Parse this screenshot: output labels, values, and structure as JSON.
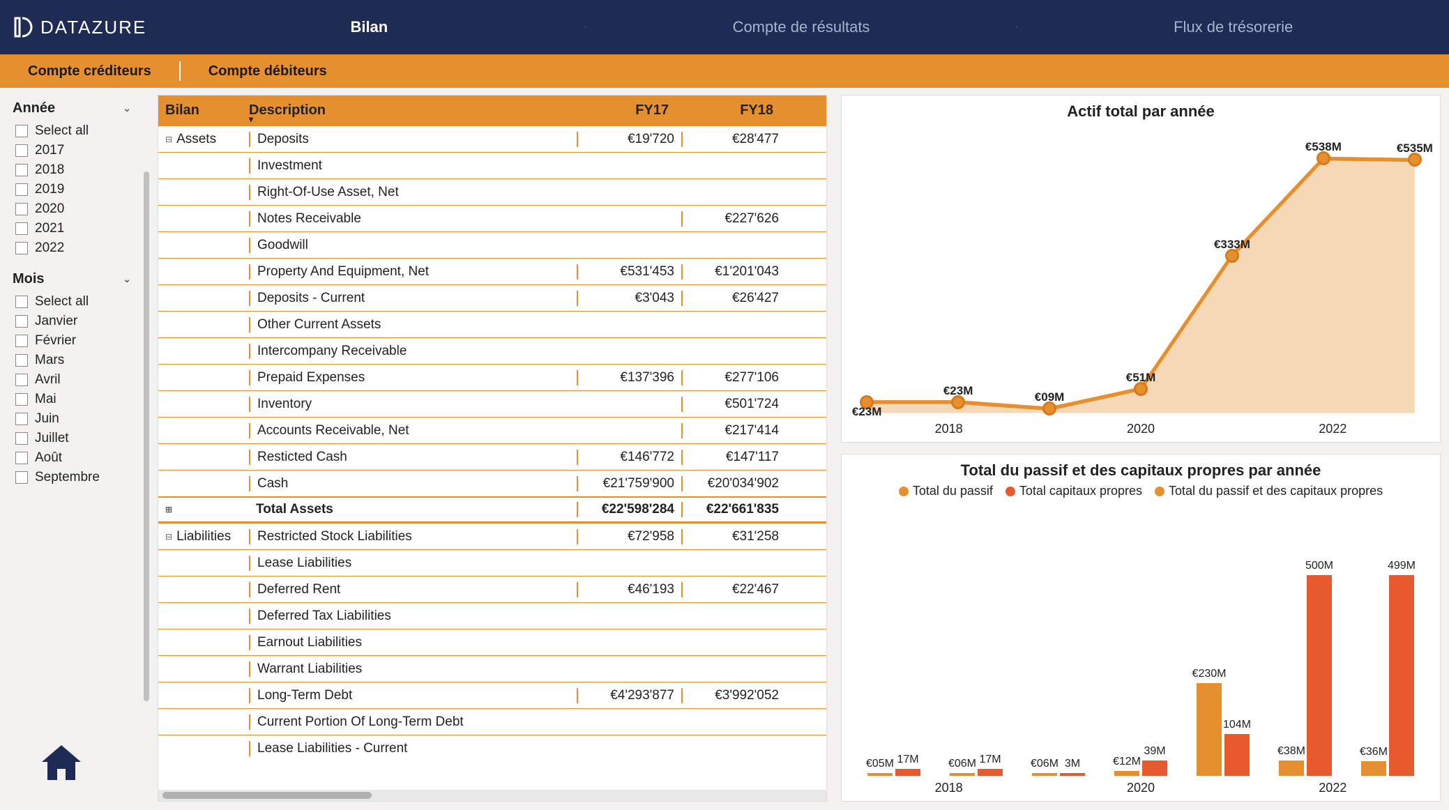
{
  "brand": "DATAZURE",
  "topnav": {
    "tabs": [
      {
        "label": "Bilan",
        "active": true
      },
      {
        "label": "Compte de résultats",
        "active": false
      },
      {
        "label": "Flux de trésorerie",
        "active": false
      }
    ]
  },
  "subnav": {
    "tabs": [
      {
        "label": "Compte créditeurs"
      },
      {
        "label": "Compte débiteurs"
      }
    ]
  },
  "filters": {
    "year": {
      "title": "Année",
      "select_all": "Select all",
      "items": [
        "2017",
        "2018",
        "2019",
        "2020",
        "2021",
        "2022"
      ]
    },
    "month": {
      "title": "Mois",
      "select_all": "Select all",
      "items": [
        "Janvier",
        "Février",
        "Mars",
        "Avril",
        "Mai",
        "Juin",
        "Juillet",
        "Août",
        "Septembre"
      ]
    }
  },
  "table": {
    "headers": {
      "bilan": "Bilan",
      "desc": "Description",
      "fy17": "FY17",
      "fy18": "FY18"
    },
    "groups": [
      {
        "name": "Assets",
        "expanded": true,
        "rows": [
          {
            "desc": "Deposits",
            "fy17": "€19'720",
            "fy18": "€28'477"
          },
          {
            "desc": "Investment",
            "fy17": "",
            "fy18": ""
          },
          {
            "desc": "Right-Of-Use Asset, Net",
            "fy17": "",
            "fy18": ""
          },
          {
            "desc": "Notes Receivable",
            "fy17": "",
            "fy18": "€227'626"
          },
          {
            "desc": "Goodwill",
            "fy17": "",
            "fy18": ""
          },
          {
            "desc": "Property And Equipment, Net",
            "fy17": "€531'453",
            "fy18": "€1'201'043"
          },
          {
            "desc": "Deposits - Current",
            "fy17": "€3'043",
            "fy18": "€26'427"
          },
          {
            "desc": "Other Current Assets",
            "fy17": "",
            "fy18": ""
          },
          {
            "desc": "Intercompany Receivable",
            "fy17": "",
            "fy18": ""
          },
          {
            "desc": "Prepaid Expenses",
            "fy17": "€137'396",
            "fy18": "€277'106"
          },
          {
            "desc": "Inventory",
            "fy17": "",
            "fy18": "€501'724"
          },
          {
            "desc": "Accounts Receivable, Net",
            "fy17": "",
            "fy18": "€217'414"
          },
          {
            "desc": "Resticted Cash",
            "fy17": "€146'772",
            "fy18": "€147'117"
          },
          {
            "desc": "Cash",
            "fy17": "€21'759'900",
            "fy18": "€20'034'902"
          }
        ],
        "total": {
          "label": "Total Assets",
          "fy17": "€22'598'284",
          "fy18": "€22'661'835"
        }
      },
      {
        "name": "Liabilities",
        "expanded": true,
        "rows": [
          {
            "desc": "Restricted Stock Liabilities",
            "fy17": "€72'958",
            "fy18": "€31'258"
          },
          {
            "desc": "Lease Liabilities",
            "fy17": "",
            "fy18": ""
          },
          {
            "desc": "Deferred Rent",
            "fy17": "€46'193",
            "fy18": "€22'467"
          },
          {
            "desc": "Deferred Tax Liabilities",
            "fy17": "",
            "fy18": ""
          },
          {
            "desc": "Earnout Liabilities",
            "fy17": "",
            "fy18": ""
          },
          {
            "desc": "Warrant Liabilities",
            "fy17": "",
            "fy18": ""
          },
          {
            "desc": "Long-Term Debt",
            "fy17": "€4'293'877",
            "fy18": "€3'992'052"
          },
          {
            "desc": "Current Portion Of Long-Term Debt",
            "fy17": "",
            "fy18": ""
          },
          {
            "desc": "Lease Liabilities - Current",
            "fy17": "",
            "fy18": ""
          }
        ]
      }
    ]
  },
  "chart_data": [
    {
      "type": "area",
      "title": "Actif total par année",
      "x": [
        "2017",
        "2018",
        "2019",
        "2020",
        "2021",
        "2022"
      ],
      "axis_labels": [
        "2018",
        "2020",
        "2022"
      ],
      "series": [
        {
          "name": "Actif total",
          "color": "#e58f2e",
          "values": [
            23,
            23,
            9,
            51,
            333,
            538,
            535
          ],
          "point_labels": [
            "€23M",
            "€23M",
            "€09M",
            "€51M",
            "€333M",
            "€538M",
            "€535M"
          ]
        }
      ],
      "ylim": [
        0,
        560
      ],
      "unit": "M€"
    },
    {
      "type": "bar",
      "title": "Total du passif et des capitaux propres par année",
      "legend": [
        {
          "name": "Total du passif",
          "color": "#e58f2e"
        },
        {
          "name": "Total capitaux propres",
          "color": "#e85a2e"
        },
        {
          "name": "Total du passif et des capitaux propres",
          "color": "#e58f2e"
        }
      ],
      "categories": [
        "2017",
        "2018",
        "2019",
        "2020",
        "2021",
        "2022"
      ],
      "axis_labels": [
        "2018",
        "2020",
        "2022"
      ],
      "series": [
        {
          "name": "Total du passif",
          "color": "#e58f2e",
          "values": [
            5,
            6,
            6,
            12,
            230,
            38,
            36
          ],
          "labels": [
            "€05M",
            "€06M",
            "€06M",
            "€12M",
            "€230M",
            "€38M",
            "€36M"
          ]
        },
        {
          "name": "Total capitaux propres",
          "color": "#e85a2e",
          "values": [
            17,
            17,
            3,
            39,
            104,
            500,
            499
          ],
          "labels": [
            "17M",
            "17M",
            "3M",
            "39M",
            "104M",
            "500M",
            "499M"
          ]
        }
      ],
      "ylim": [
        0,
        520
      ],
      "unit": "M€"
    }
  ],
  "colors": {
    "brand_dark": "#1e2b55",
    "accent": "#e58f2e",
    "accent2": "#e85a2e"
  }
}
